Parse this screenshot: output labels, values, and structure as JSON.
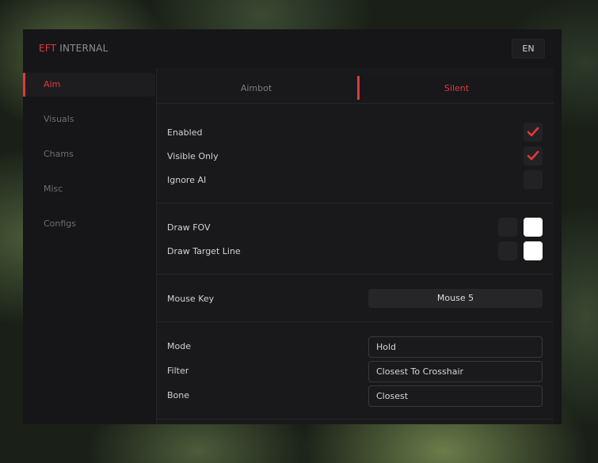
{
  "window": {
    "title_accent": "EFT",
    "title_rest": "INTERNAL",
    "language_button": "EN"
  },
  "colors": {
    "accent": "#e2383c",
    "panel_bg": "#161618",
    "content_bg": "#19191b"
  },
  "sidebar": {
    "items": [
      {
        "label": "Aim",
        "active": true
      },
      {
        "label": "Visuals",
        "active": false
      },
      {
        "label": "Chams",
        "active": false
      },
      {
        "label": "Misc",
        "active": false
      },
      {
        "label": "Configs",
        "active": false
      }
    ]
  },
  "tabs": [
    {
      "label": "Aimbot",
      "active": false
    },
    {
      "label": "Silent",
      "active": true
    }
  ],
  "toggles": [
    {
      "label": "Enabled",
      "checked": true,
      "icon": "check-icon"
    },
    {
      "label": "Visible Only",
      "checked": true,
      "icon": "check-icon"
    },
    {
      "label": "Ignore AI",
      "checked": false
    }
  ],
  "draw_options": [
    {
      "label": "Draw FOV"
    },
    {
      "label": "Draw Target Line"
    }
  ],
  "mouse_key": {
    "label": "Mouse Key",
    "value": "Mouse 5"
  },
  "selects": [
    {
      "label": "Mode",
      "value": "Hold"
    },
    {
      "label": "Filter",
      "value": "Closest To Crosshair"
    },
    {
      "label": "Bone",
      "value": "Closest"
    }
  ]
}
